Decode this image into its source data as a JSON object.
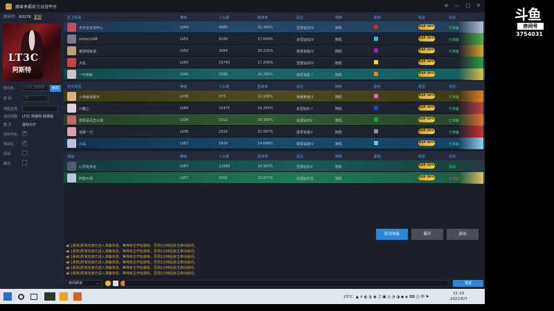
{
  "window": {
    "title": "魔兽争霸官方对战平台"
  },
  "sidebar": {
    "room_label": "房间号:",
    "room_number": "63276",
    "copy_label": "复制",
    "fields": [
      {
        "label": "房间名",
        "placeholder": "LT3C 阿斯特"
      },
      {
        "label": "密 码",
        "placeholder": "无"
      },
      {
        "label": "地图选择",
        "value": ""
      },
      {
        "label": "当前地图",
        "value": "LT3C 阿斯特 联赛版"
      },
      {
        "label": "模 式",
        "value": "游戏大厅"
      }
    ],
    "modify_button": "修改",
    "options": [
      {
        "label": "自动开始",
        "checked": true
      },
      {
        "label": "观战位",
        "checked": true
      },
      {
        "label": "观战",
        "checked": false
      },
      {
        "label": "裁决",
        "checked": false
      }
    ],
    "avatar_text": "LT3C",
    "avatar_subtext": "阿斯特"
  },
  "table": {
    "team1_header": [
      "近卫军团",
      "等级",
      "人头数",
      "胜率率",
      "段位",
      "种族",
      "颜色",
      "经验",
      "状态"
    ],
    "team2_header": [
      "天灾军团",
      "等级",
      "人头数",
      "胜率率",
      "段位",
      "种族",
      "颜色",
      "经验",
      "状态"
    ],
    "obs_header": [
      "观战",
      "等级",
      "人头数",
      "胜率率",
      "段位",
      "种族",
      "颜色",
      "经验",
      "状态"
    ],
    "team1": [
      {
        "name": "天天在长剑开心",
        "level": "LV49",
        "kills": "9960",
        "rate": "21.444%",
        "rank": "至尊钻石IV",
        "race": "随机",
        "color": "#e02020",
        "exp": "EXP 50%",
        "status": "已准备",
        "style": "self",
        "avatar": "#c84a5a",
        "hero": "#b8c0d8"
      },
      {
        "name": "victory168",
        "level": "LV51",
        "kills": "6209",
        "rate": "17.644%",
        "rank": "永恒钻石IV",
        "race": "随机",
        "color": "#20c8d0",
        "exp": "EXP 50%",
        "status": "已准备",
        "style": "plain",
        "avatar": "#7a7a8a",
        "hero": "#4ab04a"
      },
      {
        "name": "被游戏耽误",
        "level": "LV55",
        "kills": "2054",
        "rate": "20.220%",
        "rank": "尊贵铂金IV",
        "race": "随机",
        "color": "#a020c0",
        "exp": "EXP 50%",
        "status": "已准备",
        "style": "plain",
        "avatar": "#c0a070",
        "hero": "#e0a020"
      },
      {
        "name": "大名",
        "level": "LV65",
        "kills": "15743",
        "rate": "17.209%",
        "rank": "至尊钻石IV",
        "race": "随机",
        "color": "#e0e020",
        "exp": "EXP 50%",
        "status": "",
        "style": "plain",
        "avatar": "#d04040",
        "hero": "#30a040"
      },
      {
        "name": "一叶知秋",
        "level": "LV46",
        "kills": "5589",
        "rate": "20.280%",
        "rank": "尊贵铂金 I",
        "race": "随机",
        "color": "#f08020",
        "exp": "EXP 50%",
        "status": "",
        "style": "teal",
        "avatar": "#d8c0c8",
        "hero": "#e0c040"
      }
    ],
    "team2": [
      {
        "name": "小林解说者天",
        "level": "LV38",
        "kills": "973",
        "rate": "22.198%",
        "rank": "荣耀黄金III",
        "race": "随机",
        "color": "#e060c0",
        "exp": "EXP 50%",
        "status": "已准备",
        "style": "gold",
        "avatar": "#e0b080",
        "hero": "#e08020"
      },
      {
        "name": "川霸上",
        "level": "LV64",
        "kills": "15475",
        "rate": "19.293%",
        "rank": "永恒钻石 I",
        "race": "随机",
        "color": "#2040d0",
        "exp": "EXP 50%",
        "status": "已准备",
        "style": "plain",
        "avatar": "#e0d0d8",
        "hero": "#c04040"
      },
      {
        "name": "想想喜风怎么搞",
        "level": "LV34",
        "kills": "5312",
        "rate": "16.300%",
        "rank": "永恒钻石V",
        "race": "随机",
        "color": "#20a030",
        "exp": "EXP 50%",
        "status": "已准备",
        "style": "green",
        "avatar": "#d06070",
        "hero": "#e07030"
      },
      {
        "name": "怕得一刀",
        "level": "LV36",
        "kills": "2316",
        "rate": "21.567%",
        "rank": "尊贵铂金V",
        "race": "随机",
        "color": "#909090",
        "exp": "EXP 50%",
        "status": "已准备",
        "style": "plain",
        "avatar": "#e0a0a8",
        "hero": "#d03030"
      },
      {
        "name": "小白",
        "level": "LV67",
        "kills": "5424",
        "rate": "14.646%",
        "rank": "尊贵铂金IV",
        "race": "随机",
        "color": "#60c0f0",
        "exp": "EXP 50%",
        "status": "已准备",
        "style": "blue",
        "avatar": "#c0c0d8",
        "hero": "#8ad0e8"
      }
    ],
    "observers": [
      {
        "name": "心灵有多远",
        "level": "LV67",
        "kills": "12589",
        "rate": "16.993%",
        "rank": "至尊钻石V",
        "race": "随机",
        "color": "",
        "exp": "EXP 50%",
        "status": "观战",
        "style": "obs1",
        "avatar": "#505a70",
        "hero": "#303848"
      },
      {
        "name": "阿智大师",
        "level": "LV57",
        "kills": "5005",
        "rate": "23.877%",
        "rank": "永恒钻石五",
        "race": "随机",
        "color": "",
        "exp": "EXP 50%",
        "status": "未准备",
        "style": "obs2",
        "avatar": "#c0c8e0",
        "hero": "#e0c060"
      }
    ]
  },
  "actions": {
    "ready": "取消准备",
    "leave": "离开",
    "exit": "退出"
  },
  "chat": {
    "lines": [
      "[系统]所有玩家已进入准备状态，等待房主开始游戏，否则1分钟后房主移出房间。",
      "[系统]所有玩家已进入准备状态，等待房主开始游戏，否则1分钟后房主移出房间。",
      "[系统]所有玩家已进入准备状态，等待房主开始游戏，否则1分钟后房主移出房间。",
      "[系统]所有玩家已进入准备状态，等待房主开始游戏，否则1分钟后房主移出房间。",
      "[系统]所有玩家已进入准备状态，等待房主开始游戏，否则1分钟后房主移出房间。",
      "[系统]所有玩家已进入准备状态，等待房主开始游戏，否则1分钟后房主移出房间。"
    ],
    "channel": "房间频道",
    "send": "发送"
  },
  "taskbar": {
    "weather": "23°C",
    "time": "21:10",
    "date": "2022/6/7"
  },
  "stream": {
    "logo": "斗鱼",
    "badge": "房间号",
    "room_id": "3754031"
  }
}
